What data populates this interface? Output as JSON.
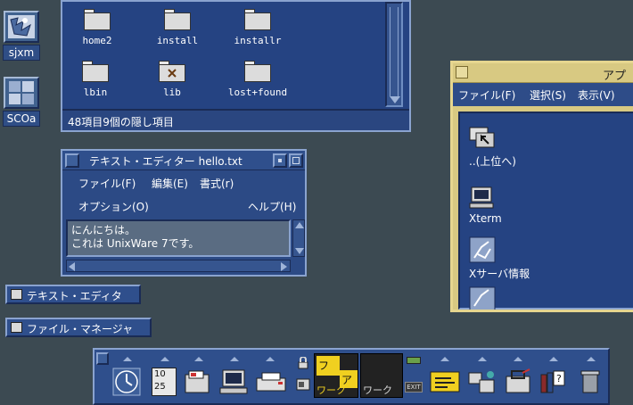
{
  "desktop_icons": [
    {
      "label": "sjxm"
    },
    {
      "label": "SCOa"
    }
  ],
  "file_manager": {
    "files": [
      "home2",
      "install",
      "installr",
      "lbin",
      "lib",
      "lost+found"
    ],
    "status": "48項目9個の隠し項目"
  },
  "text_editor": {
    "title": "テキスト・エディター hello.txt",
    "menus": {
      "file": "ファイル(F)",
      "edit": "編集(E)",
      "format": "書式(r)",
      "options": "オプション(O)",
      "help": "ヘルプ(H)"
    },
    "content_line1": "にんにちは。",
    "content_line2": "これは UnixWare 7です。"
  },
  "app_window": {
    "title": "アプ",
    "menus": {
      "file": "ファイル(F)",
      "select": "選択(S)",
      "view": "表示(V)"
    },
    "items": [
      "..(上位へ)",
      "Xterm",
      "Xサーバ情報"
    ]
  },
  "minimized": {
    "text_editor": "テキスト・エディタ",
    "file_manager": "ファイル・マネージャ"
  },
  "panel": {
    "calendar_top": "10",
    "calendar_bottom": "25",
    "workspace_label_1": "フ",
    "workspace_label_2": "ア",
    "workspace_active": "ワーク",
    "workspace_inactive": "ワーク",
    "exit_label": "EXIT"
  }
}
